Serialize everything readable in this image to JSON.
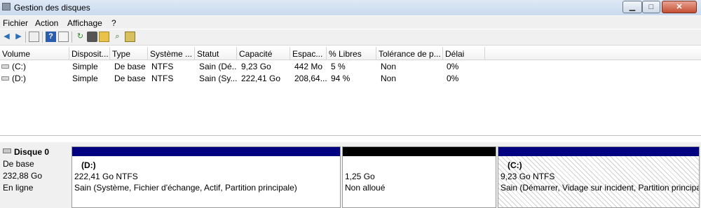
{
  "window": {
    "title": "Gestion des disques",
    "controls": {
      "minimize": "▁",
      "maximize": "□",
      "close": "✕"
    }
  },
  "menu": [
    "Fichier",
    "Action",
    "Affichage",
    "?"
  ],
  "toolbar_icons": [
    "back-arrow-icon",
    "forward-arrow-icon",
    "show-hide-console-tree-icon",
    "help-icon",
    "properties-icon",
    "refresh-icon",
    "rescan-disks-icon",
    "open-icon",
    "search-icon",
    "export-icon"
  ],
  "volume_list": {
    "columns": [
      "Volume",
      "Disposit...",
      "Type",
      "Système ...",
      "Statut",
      "Capacité",
      "Espac...",
      "% Libres",
      "Tolérance de p...",
      "Délai"
    ],
    "rows": [
      [
        "(C:)",
        "Simple",
        "De base",
        "NTFS",
        "Sain (Dé...",
        "9,23 Go",
        "442 Mo",
        "5 %",
        "Non",
        "0%"
      ],
      [
        "(D:)",
        "Simple",
        "De base",
        "NTFS",
        "Sain (Sy...",
        "222,41 Go",
        "208,64...",
        "94 %",
        "Non",
        "0%"
      ]
    ]
  },
  "disk": {
    "name": "Disque 0",
    "type": "De base",
    "size": "232,88 Go",
    "status": "En ligne",
    "partitions": [
      {
        "label": "(D:)",
        "size": "222,41 Go NTFS",
        "status": "Sain (Système, Fichier d'échange, Actif, Partition principale)",
        "bar_color": "#000080"
      },
      {
        "label": "",
        "size": "1,25 Go",
        "status": "Non alloué",
        "bar_color": "#000000"
      },
      {
        "label": "(C:)",
        "size": "9,23 Go NTFS",
        "status": "Sain (Démarrer, Vidage sur incident, Partition principale)",
        "bar_color": "#000080"
      }
    ]
  }
}
